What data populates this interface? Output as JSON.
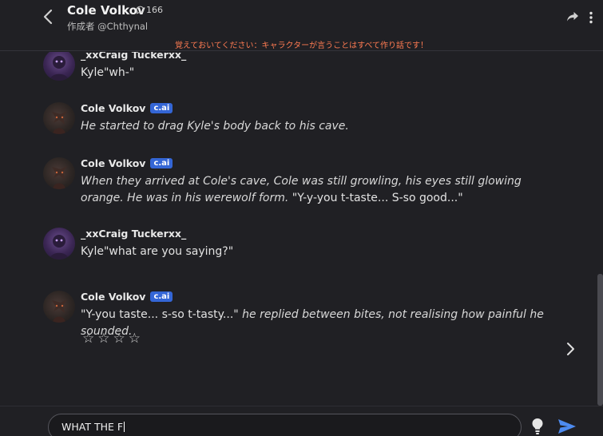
{
  "header": {
    "title": "Cole Volkov",
    "chat_count": "166",
    "creator": "作成者 @Chthynal",
    "disclaimer": "覚えておいてください：キャラクターが言うことはすべて作り話です！"
  },
  "badge_label": "c.ai",
  "messages": [
    {
      "author": "_xxCraig Tuckerxx_",
      "role": "user",
      "text": "Kyle\"wh-\""
    },
    {
      "author": "Cole Volkov",
      "role": "bot",
      "italic": "He started to drag Kyle's body back to his cave."
    },
    {
      "author": "Cole Volkov",
      "role": "bot",
      "italic": "When they arrived at Cole's cave, Cole was still growling, his eyes still glowing orange. He was in his werewolf form.",
      "plain": " \"Y-y-you t-taste... S-so good...\""
    },
    {
      "author": "_xxCraig Tuckerxx_",
      "role": "user",
      "text": "Kyle\"what are you saying?\""
    },
    {
      "author": "Cole Volkov",
      "role": "bot",
      "plain": "\"Y-you taste... s-so t-tasty...\"",
      "italic": " he replied between bites, not realising how painful he sounded."
    }
  ],
  "rating": {
    "stars": [
      "☆",
      "☆",
      "☆",
      "☆"
    ],
    "value": 0
  },
  "composer": {
    "value": "WHAT THE F"
  },
  "icons": {
    "back": "chevron-left-icon",
    "chat": "chat-bubble-icon",
    "share": "share-icon",
    "menu": "kebab-menu-icon",
    "next": "chevron-right-icon",
    "bulb": "lightbulb-icon",
    "send": "send-icon"
  },
  "colors": {
    "background": "#202024",
    "badge": "#3466d6",
    "disclaimer": "#ff7b52",
    "send": "#4d8bf0"
  }
}
